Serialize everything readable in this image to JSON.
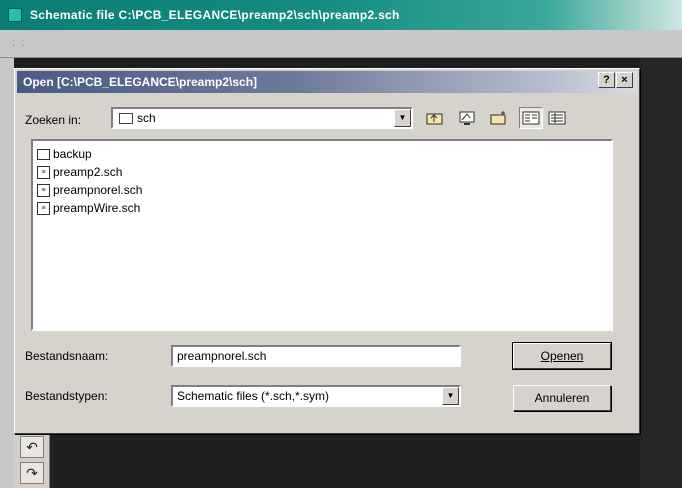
{
  "app": {
    "title": "Schematic file C:\\PCB_ELEGANCE\\preamp2\\sch\\preamp2.sch",
    "dots": ": :"
  },
  "dialog": {
    "title": "Open  [C:\\PCB_ELEGANCE\\preamp2\\sch]",
    "help_label": "?",
    "close_label": "×",
    "lookin_label": "Zoeken in:",
    "lookin_value": "sch",
    "files": [
      {
        "name": "backup",
        "type": "folder"
      },
      {
        "name": "preamp2.sch",
        "type": "file"
      },
      {
        "name": "preampnorel.sch",
        "type": "file"
      },
      {
        "name": "preampWire.sch",
        "type": "file"
      }
    ],
    "filename_label": "Bestandsnaam:",
    "filename_value": "preampnorel.sch",
    "filetype_label": "Bestandstypen:",
    "filetype_value": "Schematic files (*.sch,*.sym)",
    "open_button": "Openen",
    "cancel_button": "Annuleren"
  },
  "toolbar_icons": [
    "up-folder-icon",
    "desktop-icon",
    "new-folder-icon",
    "list-view-icon",
    "details-view-icon"
  ],
  "colors": {
    "app_titlebar": "#0b7e76",
    "dialog_titlebar": "#4a5a82",
    "dialog_face": "#d6d3cc"
  }
}
